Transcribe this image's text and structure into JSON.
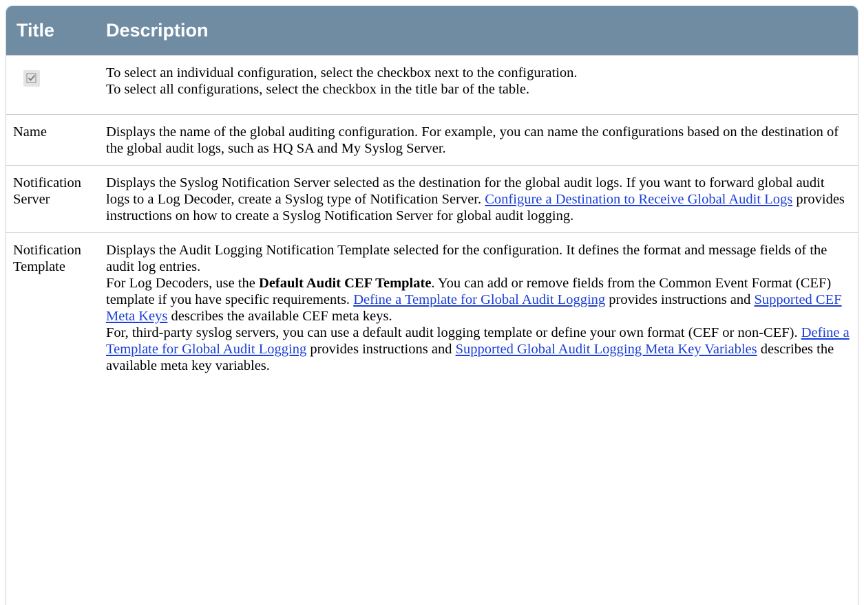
{
  "header": {
    "title_col": "Title",
    "description_col": "Description"
  },
  "rows": [
    {
      "title_icon": "checkbox-icon",
      "desc_line_1": "To select an individual configuration, select the checkbox next to the configuration.",
      "desc_line_2": " To select all configurations, select the checkbox in the title bar of the table."
    },
    {
      "title": "Name",
      "desc": "Displays the name of the global auditing configuration. For example, you can name the configurations based on the destination of the global audit logs, such as HQ SA and My Syslog Server."
    },
    {
      "title": "Notification Server",
      "desc_before": "Displays the Syslog Notification Server selected as the destination for the global audit logs. If you want to forward global audit logs to a Log Decoder, create a Syslog type of Notification Server. ",
      "link": "Configure a Destination to Receive Global Audit Logs",
      "desc_after": " provides instructions on how to create a Syslog Notification Server for global audit logging."
    },
    {
      "title": "Notification Template",
      "p1": "Displays the Audit Logging Notification Template selected for the configuration. It defines the format and message fields of the audit log entries.",
      "p2_before": " For Log Decoders, use the ",
      "p2_bold": "Default Audit CEF Template",
      "p2_mid": ". You can add or remove fields from the Common Event Format (CEF) template if you have specific requirements. ",
      "p2_link1": "Define a Template for Global Audit Logging",
      "p2_mid2": " provides instructions and ",
      "p2_link2": "Supported CEF Meta Keys",
      "p2_after": " describes the available CEF meta keys.",
      "p3_before": " For, third-party syslog servers, you can use a default audit logging template or define your own format (CEF or non-CEF). ",
      "p3_link1": "Define a Template for Global Audit Logging",
      "p3_mid": " provides instructions and ",
      "p3_link2": "Supported Global Audit Logging Meta Key Variables",
      "p3_after": " describes the available meta key variables."
    }
  ]
}
